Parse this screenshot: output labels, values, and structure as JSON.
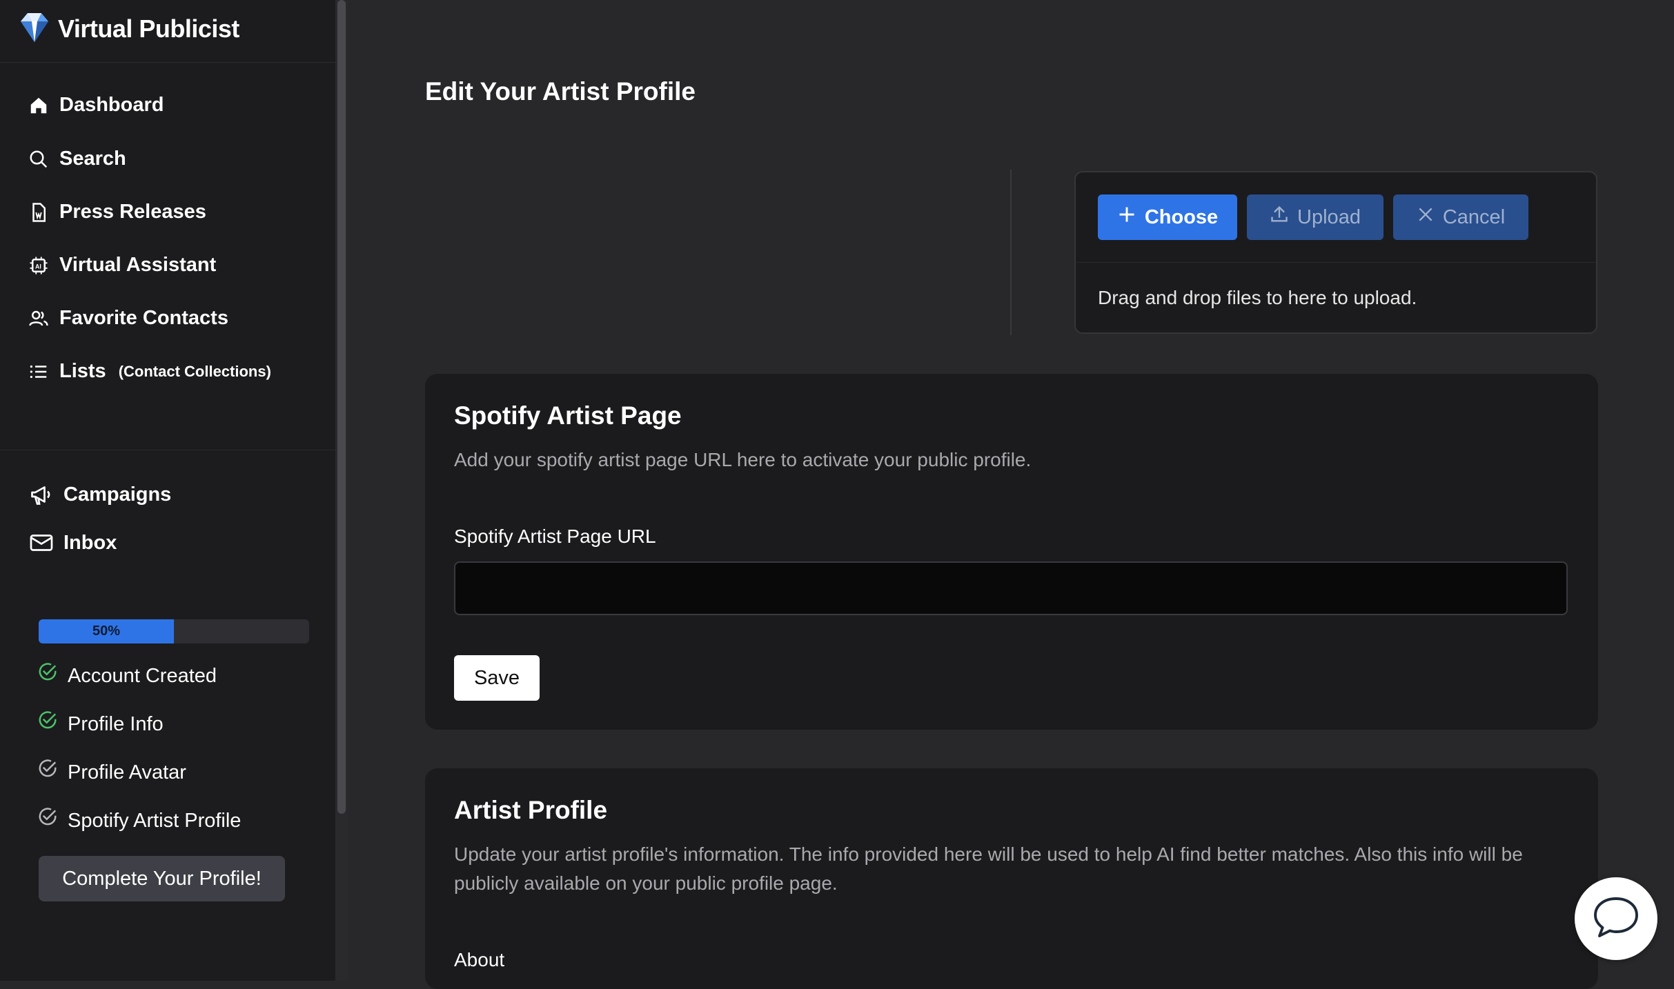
{
  "app": {
    "name": "Virtual Publicist",
    "logo_icon": "diamond-logo-icon"
  },
  "sidebar": {
    "nav": [
      {
        "label": "Dashboard",
        "icon": "home-icon"
      },
      {
        "label": "Search",
        "icon": "search-icon"
      },
      {
        "label": "Press Releases",
        "icon": "document-icon"
      },
      {
        "label": "Virtual Assistant",
        "icon": "ai-chip-icon"
      },
      {
        "label": "Favorite Contacts",
        "icon": "users-icon"
      },
      {
        "label": "Lists",
        "sub": "(Contact Collections)",
        "icon": "list-icon"
      }
    ],
    "secondary": [
      {
        "label": "Campaigns",
        "icon": "megaphone-icon"
      },
      {
        "label": "Inbox",
        "icon": "mail-icon"
      }
    ],
    "progress": {
      "value": 50,
      "label": "50%"
    },
    "checklist": [
      {
        "label": "Account Created",
        "done": true
      },
      {
        "label": "Profile Info",
        "done": true
      },
      {
        "label": "Profile Avatar",
        "done": false
      },
      {
        "label": "Spotify Artist Profile",
        "done": false
      }
    ],
    "complete_button": "Complete Your Profile!"
  },
  "main": {
    "title": "Edit Your Artist Profile",
    "upload": {
      "choose": "Choose",
      "upload": "Upload",
      "cancel": "Cancel",
      "hint": "Drag and drop files to here to upload."
    },
    "spotify": {
      "title": "Spotify Artist Page",
      "description": "Add your spotify artist page URL here to activate your public profile.",
      "field_label": "Spotify Artist Page URL",
      "field_value": "",
      "save": "Save"
    },
    "artist_profile": {
      "title": "Artist Profile",
      "description": "Update your artist profile's information. The info provided here will be used to help AI find better matches. Also this info will be publicly available on your public profile page.",
      "about_label": "About"
    }
  },
  "colors": {
    "accent": "#2f74e6",
    "success": "#4cc26a",
    "background": "#28282b",
    "sidebar": "#1c1c1e"
  }
}
